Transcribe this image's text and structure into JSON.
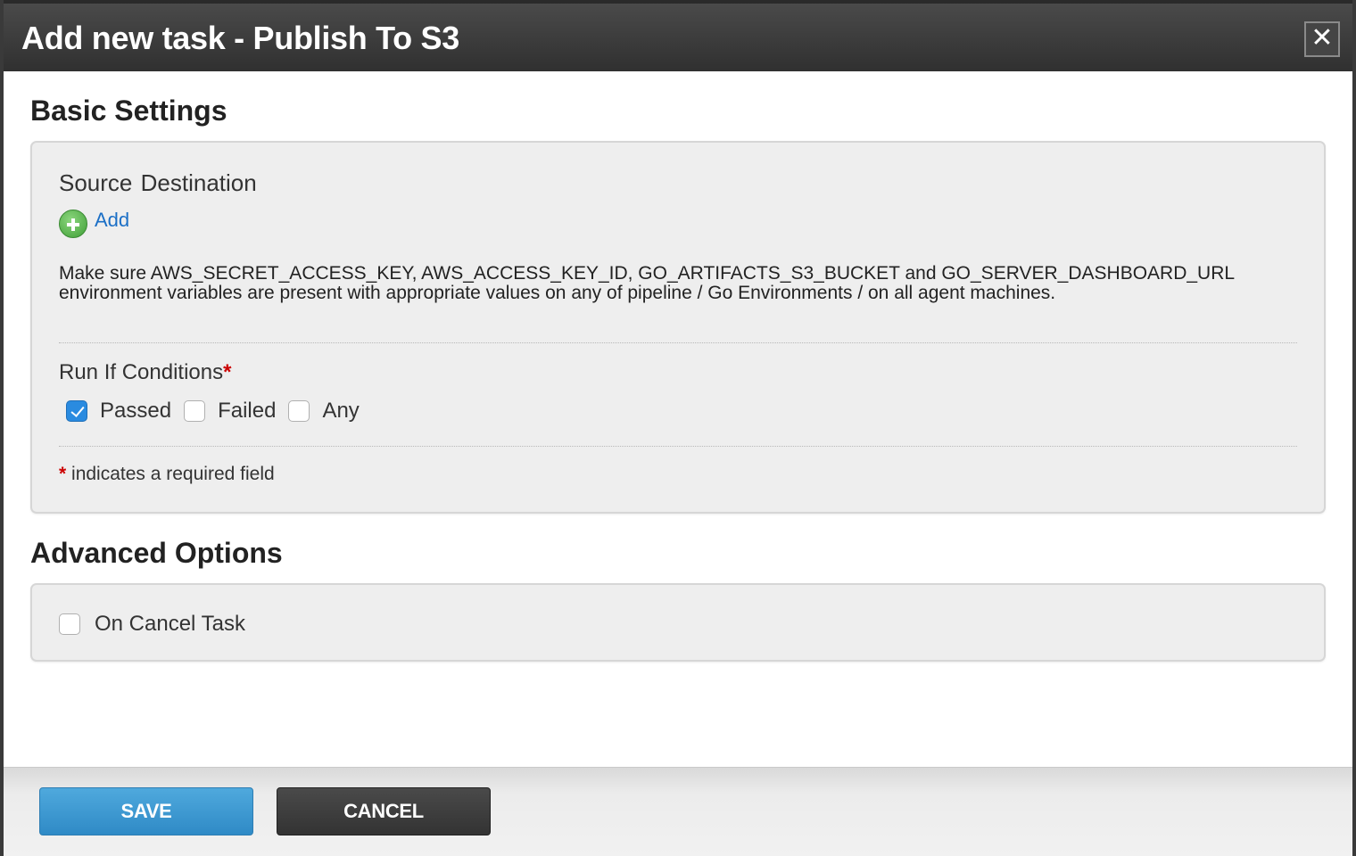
{
  "dialog": {
    "title": "Add new task - Publish To S3",
    "close_label": "✕"
  },
  "basic_settings": {
    "heading": "Basic Settings",
    "source_label": "Source",
    "destination_label": "Destination",
    "add_label": "Add",
    "help_text": "Make sure AWS_SECRET_ACCESS_KEY, AWS_ACCESS_KEY_ID, GO_ARTIFACTS_S3_BUCKET and GO_SERVER_DASHBOARD_URL environment variables are present with appropriate values on any of pipeline / Go Environments / on all agent machines.",
    "run_if_label": "Run If Conditions",
    "required_marker": "*",
    "conditions": [
      {
        "label": "Passed",
        "checked": true
      },
      {
        "label": "Failed",
        "checked": false
      },
      {
        "label": "Any",
        "checked": false
      }
    ],
    "required_note": "indicates a required field"
  },
  "advanced_options": {
    "heading": "Advanced Options",
    "on_cancel_label": "On Cancel Task",
    "on_cancel_checked": false
  },
  "footer": {
    "save_label": "SAVE",
    "cancel_label": "CANCEL"
  },
  "colors": {
    "titlebar": "#3a3a3a",
    "panel": "#eeeeee",
    "link": "#1b6fc6",
    "required": "#cc0000",
    "checkbox_checked": "#2a8be0",
    "save_button": "#3a97d0",
    "cancel_button": "#3d3d3d"
  },
  "icons": {
    "close": "close-icon",
    "add": "plus-circle-icon",
    "checkbox": "checkbox-icon"
  }
}
